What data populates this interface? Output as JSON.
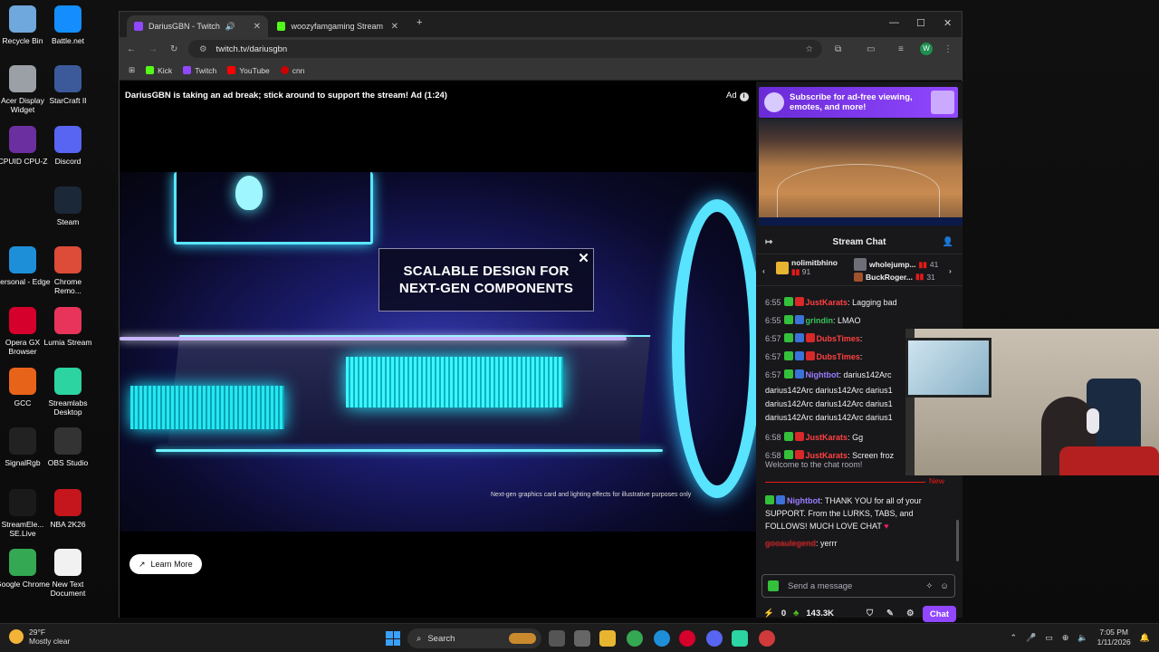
{
  "desktop": {
    "icons": [
      {
        "label": "Recycle Bin",
        "color": "#6fa8dc"
      },
      {
        "label": "Battle.net",
        "color": "#148eff"
      },
      {
        "label": "Acer Display Widget",
        "color": "#9aa0a6"
      },
      {
        "label": "StarCraft II",
        "color": "#3c5a9a"
      },
      {
        "label": "CPUID CPU-Z",
        "color": "#6b2fa0"
      },
      {
        "label": "Discord",
        "color": "#5865f2"
      },
      {
        "label": "Steam",
        "color": "#1b2838"
      },
      {
        "label": "Personal - Edge",
        "color": "#1d8fd8"
      },
      {
        "label": "Chrome Remo...",
        "color": "#dd4b39"
      },
      {
        "label": "Opera GX Browser",
        "color": "#d6002c"
      },
      {
        "label": "Lumia Stream",
        "color": "#e8345a"
      },
      {
        "label": "GCC",
        "color": "#e8631a"
      },
      {
        "label": "Streamlabs Desktop",
        "color": "#2bd4a0"
      },
      {
        "label": "SignalRgb",
        "color": "#222222"
      },
      {
        "label": "OBS Studio",
        "color": "#333333"
      },
      {
        "label": "StreamEle... SE.Live",
        "color": "#1a1a1a"
      },
      {
        "label": "NBA 2K26",
        "color": "#c4161c"
      },
      {
        "label": "Google Chrome",
        "color": "#34a853"
      },
      {
        "label": "New Text Document",
        "color": "#f1f1f1"
      }
    ]
  },
  "browser": {
    "tabs": [
      {
        "title": "DariusGBN - Twitch",
        "color": "#9147ff",
        "active": true
      },
      {
        "title": "woozyfamgaming Stream - Wa...",
        "color": "#53fc18",
        "active": false
      }
    ],
    "url": "twitch.tv/dariusgbn",
    "profile_initial": "W",
    "bookmarks": [
      {
        "label": "Kick",
        "color": "#53fc18"
      },
      {
        "label": "Twitch",
        "color": "#9147ff"
      },
      {
        "label": "YouTube",
        "color": "#ff0000"
      },
      {
        "label": "cnn",
        "color": "#cc0000"
      }
    ]
  },
  "player": {
    "ad_message": "DariusGBN is taking an ad break; stick around to support the stream! Ad (1:24)",
    "ad_label": "Ad",
    "promo_line1": "SCALABLE DESIGN FOR",
    "promo_line2": "NEXT-GEN COMPONENTS",
    "disclaimer": "Next-gen graphics card and lighting effects for illustrative purposes only",
    "learn_more": "Learn More"
  },
  "chat": {
    "subscribe_banner": "Subscribe for ad-free viewing, emotes, and more!",
    "header": "Stream Chat",
    "leaderboard": [
      {
        "name": "nolimitbhino",
        "value": "91"
      },
      {
        "name": "wholejump...",
        "value": "41"
      },
      {
        "name": "BuckRoger...",
        "value": "31"
      }
    ],
    "messages": [
      {
        "time": "6:55",
        "user": "JustKarats",
        "user_class": "u-red",
        "text": ": Lagging bad"
      },
      {
        "time": "6:55",
        "user": "grindin",
        "user_class": "u-green",
        "text": ": LMAO"
      },
      {
        "time": "6:57",
        "user": "DubsTimes",
        "user_class": "u-red",
        "text": ":"
      },
      {
        "time": "6:57",
        "user": "DubsTimes",
        "user_class": "u-red",
        "text": ":"
      },
      {
        "time": "6:57",
        "user": "Nightbot",
        "user_class": "u-purple",
        "text": ": darius142Arc"
      }
    ],
    "spam_lines": [
      "darius142Arc darius142Arc darius1",
      "darius142Arc darius142Arc darius1",
      "darius142Arc darius142Arc darius1"
    ],
    "messages2": [
      {
        "time": "6:58",
        "user": "JustKarats",
        "user_class": "u-red",
        "text": ": Gg"
      },
      {
        "time": "6:58",
        "user": "JustKarats",
        "user_class": "u-red",
        "text": ": Screen froz"
      }
    ],
    "welcome": "Welcome to the chat room!",
    "new_label": "New",
    "nightbot_user": "Nightbot",
    "nightbot_text": ": THANK YOU for all of your SUPPORT. From the LURKS, TABS, and FOLLOWS! MUCH LOVE CHAT",
    "last_user": "gooaulegend",
    "last_text": ": yerrr",
    "input_placeholder": "Send a message",
    "points_left": "0",
    "points_right": "143.3K",
    "chat_button": "Chat"
  },
  "taskbar": {
    "temperature": "29°F",
    "weather": "Mostly clear",
    "search": "Search",
    "time": "7:05 PM",
    "date": "1/11/2026"
  }
}
